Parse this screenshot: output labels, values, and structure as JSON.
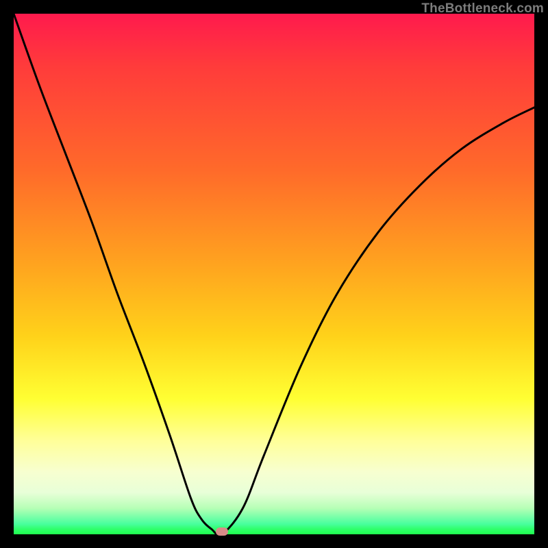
{
  "watermark": {
    "text": "TheBottleneck.com"
  },
  "chart_data": {
    "type": "line",
    "title": "",
    "xlabel": "",
    "ylabel": "",
    "xlim": [
      0,
      100
    ],
    "ylim": [
      0,
      100
    ],
    "grid": false,
    "legend": false,
    "x": [
      0,
      5,
      10,
      15,
      20,
      25,
      30,
      34,
      36,
      38,
      40,
      44,
      48,
      55,
      62,
      70,
      78,
      86,
      94,
      100
    ],
    "values": [
      100,
      86,
      73,
      60,
      46,
      33,
      19,
      7,
      3,
      1,
      0,
      5,
      15,
      32,
      46,
      58,
      67,
      74,
      79,
      82
    ],
    "minimum": {
      "x": 40,
      "y": 0
    },
    "gradient_scale": {
      "top_color": "#ff1a4d",
      "mid_color": "#ffd21a",
      "bottom_color": "#1fff4e"
    },
    "marker": {
      "x": 40,
      "y": 0,
      "color": "#d88b88"
    }
  }
}
